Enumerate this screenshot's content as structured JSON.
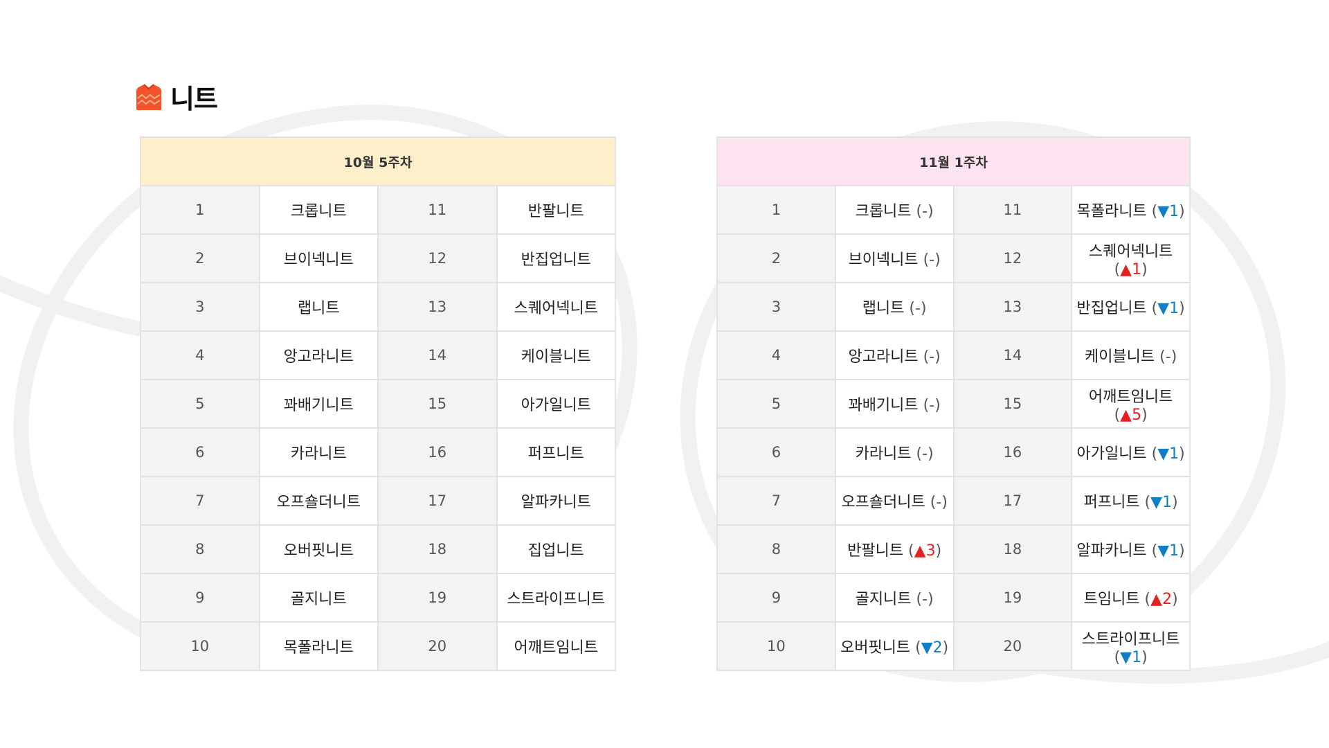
{
  "page": {
    "title": "니트",
    "icon": "sweater-icon",
    "icon_color": "#f4532a"
  },
  "colors": {
    "week1_header_bg": "#fdefc9",
    "week2_header_bg": "#fde3ef",
    "border": "#e2e2e2",
    "rank_cell_bg": "#f3f3f3",
    "up": "#e62020",
    "down": "#0f7ec4"
  },
  "table1": {
    "header": "10월 5주차",
    "rows": [
      {
        "rank_a": "1",
        "name_a": "크롭니트",
        "rank_b": "11",
        "name_b": "반팔니트"
      },
      {
        "rank_a": "2",
        "name_a": "브이넥니트",
        "rank_b": "12",
        "name_b": "반집업니트"
      },
      {
        "rank_a": "3",
        "name_a": "랩니트",
        "rank_b": "13",
        "name_b": "스퀘어넥니트"
      },
      {
        "rank_a": "4",
        "name_a": "앙고라니트",
        "rank_b": "14",
        "name_b": "케이블니트"
      },
      {
        "rank_a": "5",
        "name_a": "꽈배기니트",
        "rank_b": "15",
        "name_b": "아가일니트"
      },
      {
        "rank_a": "6",
        "name_a": "카라니트",
        "rank_b": "16",
        "name_b": "퍼프니트"
      },
      {
        "rank_a": "7",
        "name_a": "오프숄더니트",
        "rank_b": "17",
        "name_b": "알파카니트"
      },
      {
        "rank_a": "8",
        "name_a": "오버핏니트",
        "rank_b": "18",
        "name_b": "집업니트"
      },
      {
        "rank_a": "9",
        "name_a": "골지니트",
        "rank_b": "19",
        "name_b": "스트라이프니트"
      },
      {
        "rank_a": "10",
        "name_a": "목폴라니트",
        "rank_b": "20",
        "name_b": "어깨트임니트"
      }
    ]
  },
  "table2": {
    "header": "11월 1주차",
    "rows": [
      {
        "rank_a": "1",
        "name_a": "크롭니트",
        "change_a": {
          "dir": "none",
          "text": "-"
        },
        "rank_b": "11",
        "name_b": "목폴라니트",
        "change_b": {
          "dir": "down",
          "text": "1"
        }
      },
      {
        "rank_a": "2",
        "name_a": "브이넥니트",
        "change_a": {
          "dir": "none",
          "text": "-"
        },
        "rank_b": "12",
        "name_b": "스퀘어넥니트",
        "change_b": {
          "dir": "up",
          "text": "1"
        }
      },
      {
        "rank_a": "3",
        "name_a": "랩니트",
        "change_a": {
          "dir": "none",
          "text": "-"
        },
        "rank_b": "13",
        "name_b": "반집업니트",
        "change_b": {
          "dir": "down",
          "text": "1"
        }
      },
      {
        "rank_a": "4",
        "name_a": "앙고라니트",
        "change_a": {
          "dir": "none",
          "text": "-"
        },
        "rank_b": "14",
        "name_b": "케이블니트",
        "change_b": {
          "dir": "none",
          "text": "-"
        }
      },
      {
        "rank_a": "5",
        "name_a": "꽈배기니트",
        "change_a": {
          "dir": "none",
          "text": "-"
        },
        "rank_b": "15",
        "name_b": "어깨트임니트",
        "change_b": {
          "dir": "up",
          "text": "5"
        }
      },
      {
        "rank_a": "6",
        "name_a": "카라니트",
        "change_a": {
          "dir": "none",
          "text": "-"
        },
        "rank_b": "16",
        "name_b": "아가일니트",
        "change_b": {
          "dir": "down",
          "text": "1"
        }
      },
      {
        "rank_a": "7",
        "name_a": "오프숄더니트",
        "change_a": {
          "dir": "none",
          "text": "-"
        },
        "rank_b": "17",
        "name_b": "퍼프니트",
        "change_b": {
          "dir": "down",
          "text": "1"
        }
      },
      {
        "rank_a": "8",
        "name_a": "반팔니트",
        "change_a": {
          "dir": "up",
          "text": "3"
        },
        "rank_b": "18",
        "name_b": "알파카니트",
        "change_b": {
          "dir": "down",
          "text": "1"
        }
      },
      {
        "rank_a": "9",
        "name_a": "골지니트",
        "change_a": {
          "dir": "none",
          "text": "-"
        },
        "rank_b": "19",
        "name_b": "트임니트",
        "change_b": {
          "dir": "up",
          "text": "2"
        }
      },
      {
        "rank_a": "10",
        "name_a": "오버핏니트",
        "change_a": {
          "dir": "down",
          "text": "2"
        },
        "rank_b": "20",
        "name_b": "스트라이프니트",
        "change_b": {
          "dir": "down",
          "text": "1"
        }
      }
    ]
  }
}
